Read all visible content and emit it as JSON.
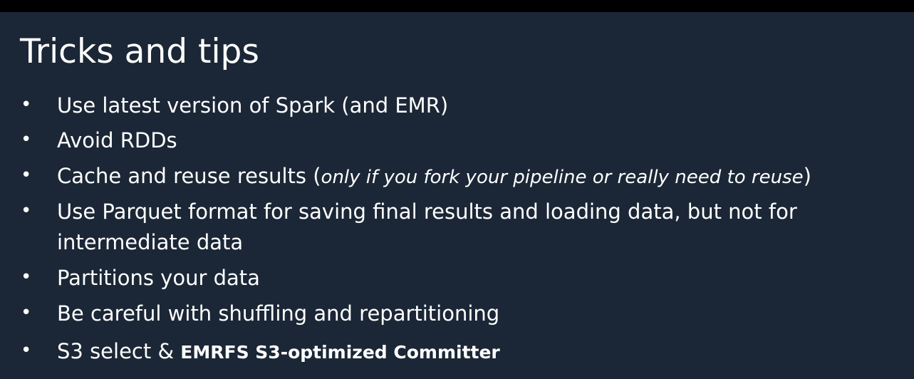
{
  "slide": {
    "title": "Tricks and tips",
    "bullet_symbol": "•",
    "items": [
      {
        "text": "Use latest version of Spark (and EMR)"
      },
      {
        "text": "Avoid RDDs"
      },
      {
        "text_before": "Cache and reuse results (",
        "text_italic": "only if you fork your pipeline or really need to reuse",
        "text_after": ")"
      },
      {
        "text": "Use Parquet format for saving final results and loading data, but not for intermediate data"
      },
      {
        "text": "Partitions your data"
      },
      {
        "text": "Be careful with shuffling and repartitioning"
      },
      {
        "text_before": "S3 select & ",
        "text_bold": "EMRFS S3-optimized Committer"
      }
    ]
  },
  "colors": {
    "background": "#1b2736",
    "top_bar": "#000000",
    "text": "#ffffff"
  }
}
